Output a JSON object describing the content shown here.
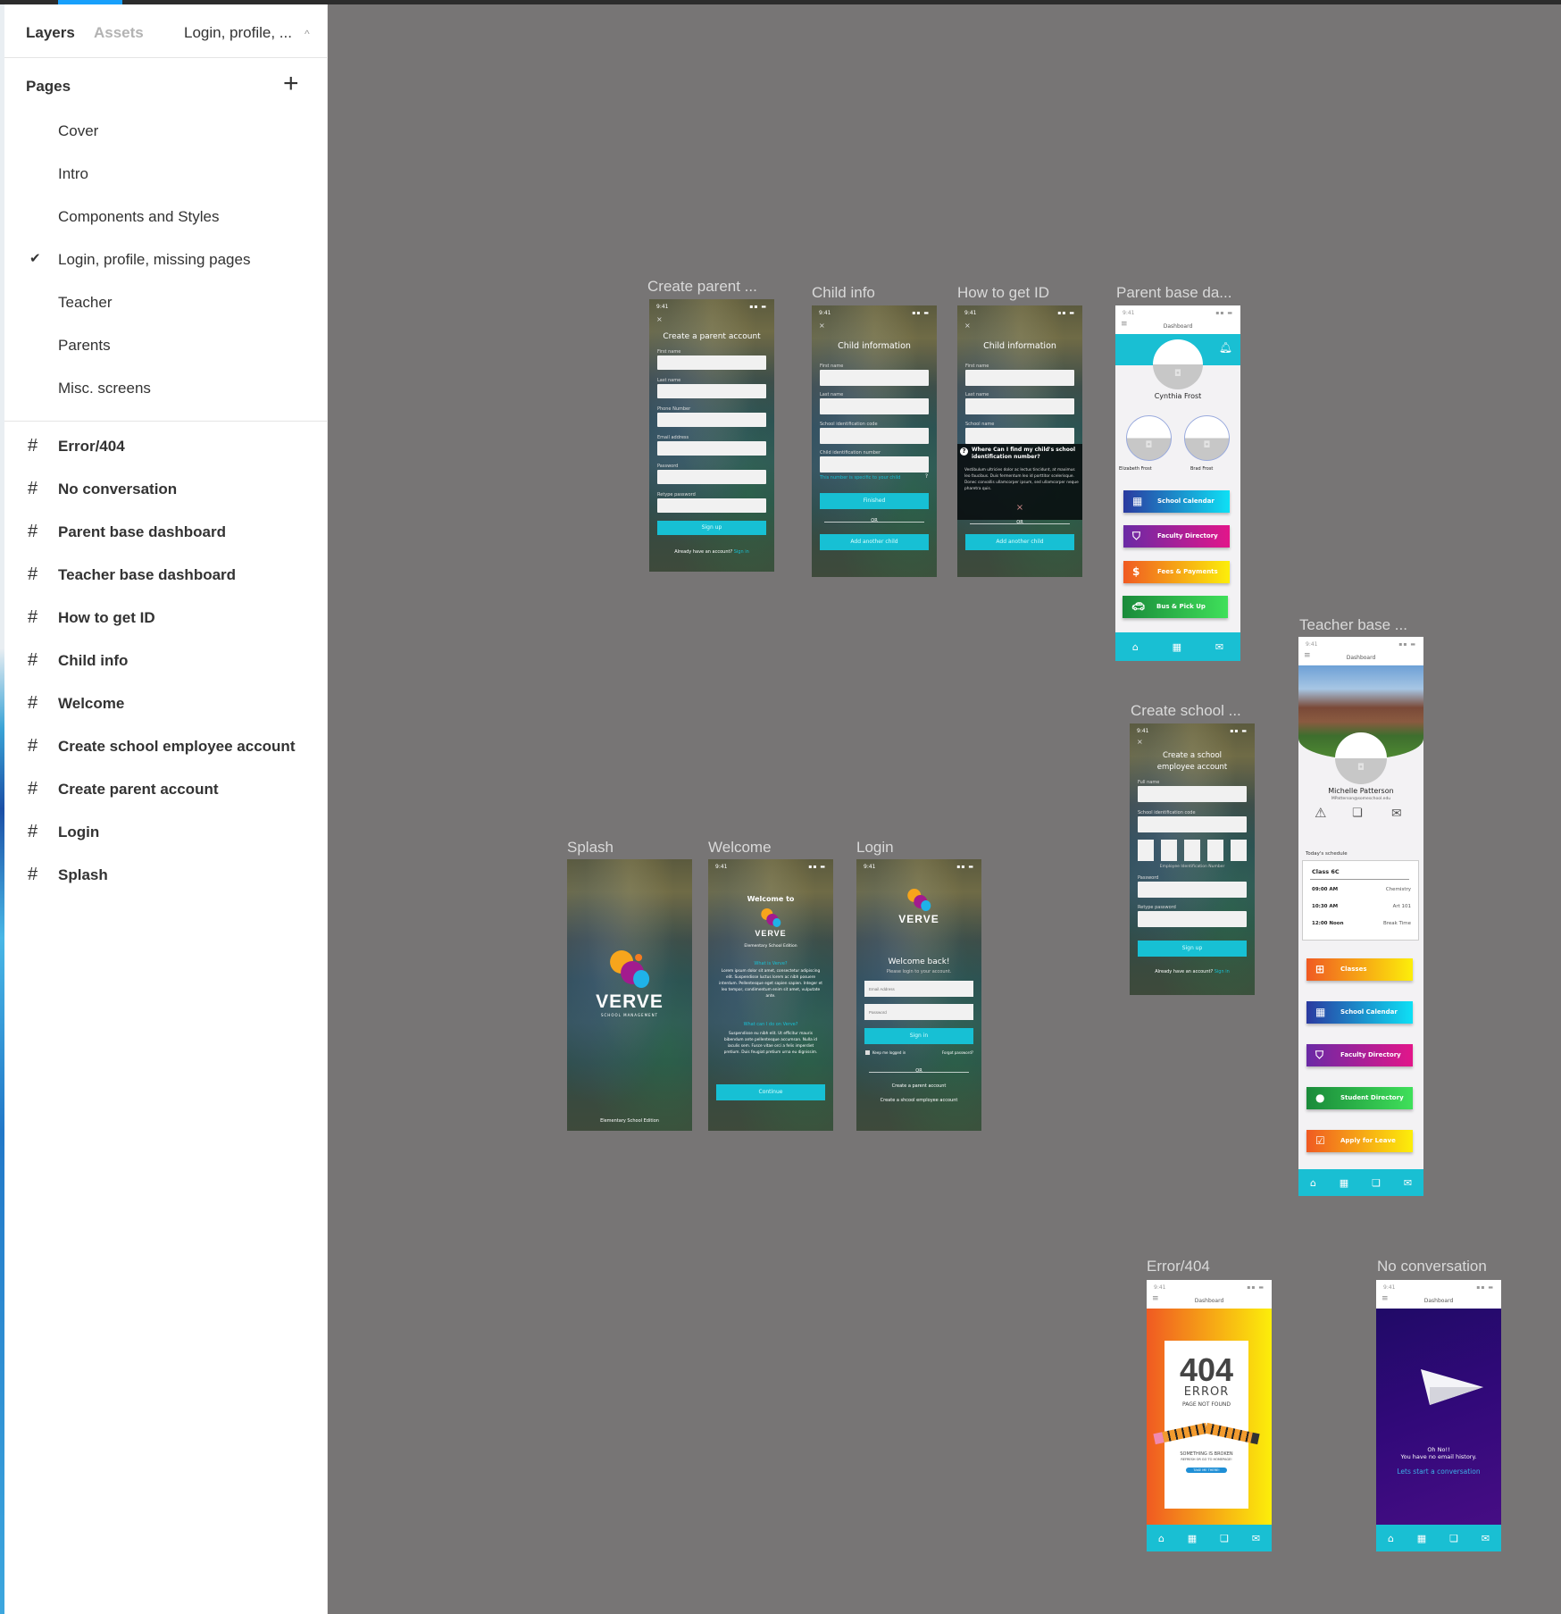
{
  "sidebar": {
    "tabs": {
      "layers": "Layers",
      "assets": "Assets",
      "current_page": "Login, profile, ..."
    },
    "pages_title": "Pages",
    "pages": [
      {
        "label": "Cover",
        "selected": false
      },
      {
        "label": "Intro",
        "selected": false
      },
      {
        "label": "Components and Styles",
        "selected": false
      },
      {
        "label": "Login, profile, missing pages",
        "selected": true
      },
      {
        "label": "Teacher",
        "selected": false
      },
      {
        "label": "Parents",
        "selected": false
      },
      {
        "label": "Misc. screens",
        "selected": false
      }
    ],
    "layers": [
      "Error/404",
      "No conversation",
      "Parent base dashboard",
      "Teacher base dashboard",
      "How to get ID",
      "Child info",
      "Welcome",
      "Create school employee account",
      "Create parent account",
      "Login",
      "Splash"
    ],
    "icons": {
      "add_page": "plus-icon",
      "checkmark": "check-icon",
      "frame": "hash-frame-icon",
      "collapse": "chevron-up-icon"
    }
  },
  "canvas": {
    "background": "#777575",
    "accent": "#19bfd3",
    "frames": {
      "create_parent": {
        "label": "Create parent ...",
        "time": "9:41",
        "title": "Create a parent account",
        "fields": [
          "First name",
          "Last name",
          "Phone Number",
          "Email address",
          "Password",
          "Retype password"
        ],
        "button": "Sign up",
        "footer": "Already have an account?",
        "footer_link": "Sign in"
      },
      "child_info": {
        "label": "Child info",
        "time": "9:41",
        "title": "Child information",
        "fields": [
          "First name",
          "Last name",
          "School identification code",
          "Child identification number"
        ],
        "hint": "This number is specific to your child",
        "button": "Finished",
        "or": "OR",
        "button2": "Add another child"
      },
      "how_to_get_id": {
        "label": "How to get ID",
        "time": "9:41",
        "title": "Child information",
        "fields": [
          "First name",
          "Last name",
          "School name"
        ],
        "popup_title": "Where Can I find my child's school identification  number?",
        "popup_body": "Vestibulum ultricies dolor ac lectus tincidunt, at maximus leo faucibus. Duis fermentum leo id porttitor scelerisque. Donec convallis ullamcorper ipsum, sed ullamcorper neque pharetra quis.",
        "or": "OR",
        "button2": "Add another child"
      },
      "parent_dashboard": {
        "label": "Parent base da...",
        "time": "9:41",
        "header": "Dashboard",
        "name": "Cynthia Frost",
        "children": [
          "Elizabeth Frost",
          "Brad Frost"
        ],
        "tiles": [
          {
            "label": "School Calendar",
            "icon": "calendar-icon",
            "style": "blue"
          },
          {
            "label": "Faculty Directory",
            "icon": "shield-icon",
            "style": "purple"
          },
          {
            "label": "Fees & Payments",
            "icon": "dollar-icon",
            "style": "orange"
          },
          {
            "label": "Bus & Pick Up",
            "icon": "car-icon",
            "style": "green"
          }
        ],
        "nav": [
          "home-icon",
          "calendar-icon",
          "mail-icon"
        ]
      },
      "teacher_dashboard": {
        "label": "Teacher base ...",
        "time": "9:41",
        "header": "Dashboard",
        "name": "Michelle Patterson",
        "email": "MPatterson@someschool.edu",
        "schedule_title": "Today's schedule",
        "class": "Class 6C",
        "schedule": [
          {
            "time": "09:00 AM",
            "subject": "Chemistry"
          },
          {
            "time": "10:30 AM",
            "subject": "Art 101"
          },
          {
            "time": "12:00 Noon",
            "subject": "Break Time"
          }
        ],
        "tiles": [
          {
            "label": "Classes",
            "icon": "grid-icon",
            "style": "orange"
          },
          {
            "label": "School Calendar",
            "icon": "calendar-icon",
            "style": "blue"
          },
          {
            "label": "Faculty Directory",
            "icon": "shield-icon",
            "style": "purple"
          },
          {
            "label": "Student Directory",
            "icon": "person-icon",
            "style": "green"
          },
          {
            "label": "Apply for Leave",
            "icon": "calendar-check-icon",
            "style": "orange"
          }
        ],
        "nav": [
          "home-icon",
          "calendar-icon",
          "chat-icon",
          "mail-icon"
        ]
      },
      "create_school": {
        "label": "Create school ...",
        "time": "9:41",
        "title": "Create a school employee account",
        "fields": [
          "Full name",
          "School identification code"
        ],
        "id_label": "Employee Identification Number",
        "fields2": [
          "Password",
          "Retype password"
        ],
        "button": "Sign up",
        "footer": "Already have an account?",
        "footer_link": "Sign in"
      },
      "splash": {
        "label": "Splash",
        "brand": "VERVE",
        "brand_sub": "SCHOOL MANAGEMENT",
        "edition": "Elementary School Edition"
      },
      "welcome": {
        "label": "Welcome",
        "time": "9:41",
        "title": "Welcome to",
        "brand": "VERVE",
        "edition": "Elementary School Edition",
        "q1": "What is Verve?",
        "a1": "Lorem ipsum dolor sit amet, consectetur adipiscing elit. Suspendisse luctus lorem ac nibh posuere interdum. Pellentesque eget sapien sapien. Integer et leo tempor, condimentum enim sit amet, vulputate ante.",
        "q2": "What can I do on Verve?",
        "a2": "Suspendisse eu nibh elit. Ut efficitur mauris bibendum ante pellentesque accumsan. Nulla id iaculis sem. Fusce vitae orci a felis imperdiet pretium. Duis feugiat pretium urna eu dignissim.",
        "button": "Continue"
      },
      "login": {
        "label": "Login",
        "time": "9:41",
        "brand": "VERVE",
        "title": "Welcome back!",
        "subtitle": "Please login to your account.",
        "email_placeholder": "Email Address",
        "password_placeholder": "Password",
        "button": "Sign in",
        "keep_logged": "Keep me logged in",
        "forgot": "Forgot password?",
        "or": "OR",
        "link1": "Create a parent account",
        "link2": "Create a shcool employee account"
      },
      "error404": {
        "label": "Error/404",
        "time": "9:41",
        "header": "Dashboard",
        "code": "404",
        "word": "ERROR",
        "msg": "PAGE NOT FOUND",
        "broken": "SOMETHING IS BROKEN",
        "hint": "REFRESH OR GO TO HOMEPAGE!",
        "button": "TAKE ME THERE!",
        "nav": [
          "home-icon",
          "calendar-icon",
          "chat-icon",
          "mail-icon"
        ]
      },
      "no_conversation": {
        "label": "No conversation",
        "time": "9:41",
        "header": "Dashboard",
        "line1": "Oh No!!",
        "line2": "You have no email history.",
        "link": "Lets start a conversation",
        "nav": [
          "home-icon",
          "calendar-icon",
          "chat-icon",
          "mail-icon"
        ]
      }
    }
  }
}
